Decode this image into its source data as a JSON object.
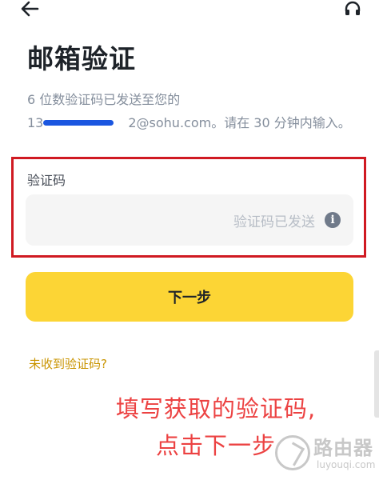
{
  "header": {
    "back_icon": "arrow-left-icon",
    "support_icon": "headset-icon"
  },
  "title": "邮箱验证",
  "description": {
    "line1": "6 位数验证码已发送至您的",
    "email_visible_start": "13",
    "email_visible_end": "2@sohu.com。请在 30 分钟内输入。"
  },
  "code_field": {
    "label": "验证码",
    "placeholder": "验证码已发送",
    "value": "",
    "info_icon": "info-icon",
    "info_glyph": "i"
  },
  "next_button": {
    "label": "下一步"
  },
  "resend_link": {
    "label": "未收到验证码?"
  },
  "annotation": {
    "line1": "填写获取的验证码,",
    "line2": "点击下一步"
  },
  "watermark": {
    "title": "路由器",
    "url": "luyouqi.com"
  },
  "colors": {
    "accent_yellow": "#fcd535",
    "link_gold": "#c99400",
    "annotation_red": "#ec4242",
    "highlight_border": "#d01a22",
    "redaction_blue": "#1a56e0"
  }
}
